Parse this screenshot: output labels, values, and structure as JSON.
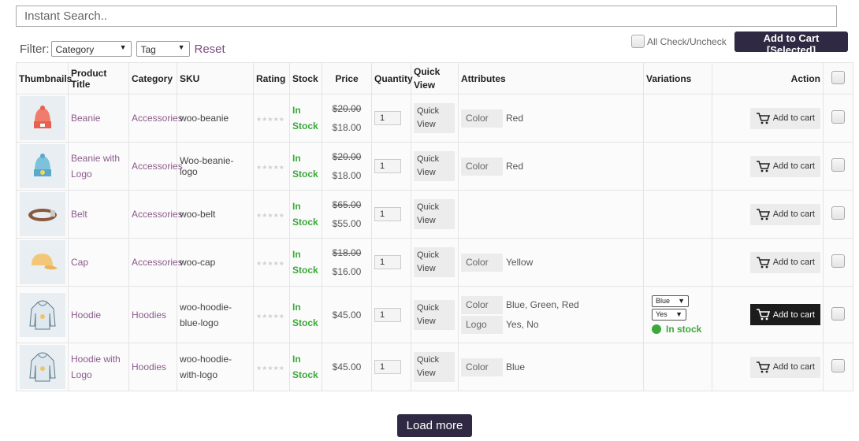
{
  "search": {
    "placeholder": "Instant Search.."
  },
  "filter": {
    "label": "Filter:",
    "category_selected": "Category",
    "tag_selected": "Tag",
    "reset_label": "Reset"
  },
  "bulk": {
    "check_all_label": "All Check/Uncheck",
    "add_selected_label": "Add to Cart [Selected]"
  },
  "table": {
    "headers": {
      "thumbnails": "Thumbnails",
      "title": "Product Title",
      "category": "Category",
      "sku": "SKU",
      "rating": "Rating",
      "stock": "Stock",
      "price": "Price",
      "quantity": "Quantity",
      "quick_view": "Quick View",
      "attributes": "Attributes",
      "variations": "Variations",
      "action": "Action"
    },
    "stars": "★★★★★",
    "stock_line1": "In",
    "stock_line2": "Stock",
    "quick_view_line1": "Quick",
    "quick_view_line2": "View",
    "add_to_cart_label": "Add to cart",
    "rows": [
      {
        "icon": "beanie-icon",
        "title": "Beanie",
        "category": "Accessories",
        "sku": "woo-beanie",
        "price_old": "$20.00",
        "price": "$18.00",
        "qty": "1",
        "attr1_key": "Color",
        "attr1_val": "Red"
      },
      {
        "icon": "beanie-logo-icon",
        "title": "Beanie with Logo",
        "category": "Accessories",
        "sku": "Woo-beanie-logo",
        "price_old": "$20.00",
        "price": "$18.00",
        "qty": "1",
        "attr1_key": "Color",
        "attr1_val": "Red"
      },
      {
        "icon": "belt-icon",
        "title": "Belt",
        "category": "Accessories",
        "sku": "woo-belt",
        "price_old": "$65.00",
        "price": "$55.00",
        "qty": "1"
      },
      {
        "icon": "cap-icon",
        "title": "Cap",
        "category": "Accessories",
        "sku": "woo-cap",
        "price_old": "$18.00",
        "price": "$16.00",
        "qty": "1",
        "attr1_key": "Color",
        "attr1_val": "Yellow"
      },
      {
        "icon": "hoodie-icon",
        "title": "Hoodie",
        "category": "Hoodies",
        "sku": "woo-hoodie-blue-logo",
        "price": "$45.00",
        "qty": "1",
        "attr1_key": "Color",
        "attr1_val": "Blue, Green, Red",
        "attr2_key": "Logo",
        "attr2_val": "Yes, No",
        "variation_color": "Blue",
        "variation_logo": "Yes",
        "variation_status": "In stock"
      },
      {
        "icon": "hoodie-logo-icon",
        "title": "Hoodie with Logo",
        "category": "Hoodies",
        "sku": "woo-hoodie-with-logo",
        "price": "$45.00",
        "qty": "1",
        "attr1_key": "Color",
        "attr1_val": "Blue"
      }
    ]
  },
  "load_more_label": "Load more",
  "colors": {
    "accent_dark": "#2f2943",
    "link": "#8b5a8c",
    "stock_green": "#3aa83a"
  }
}
